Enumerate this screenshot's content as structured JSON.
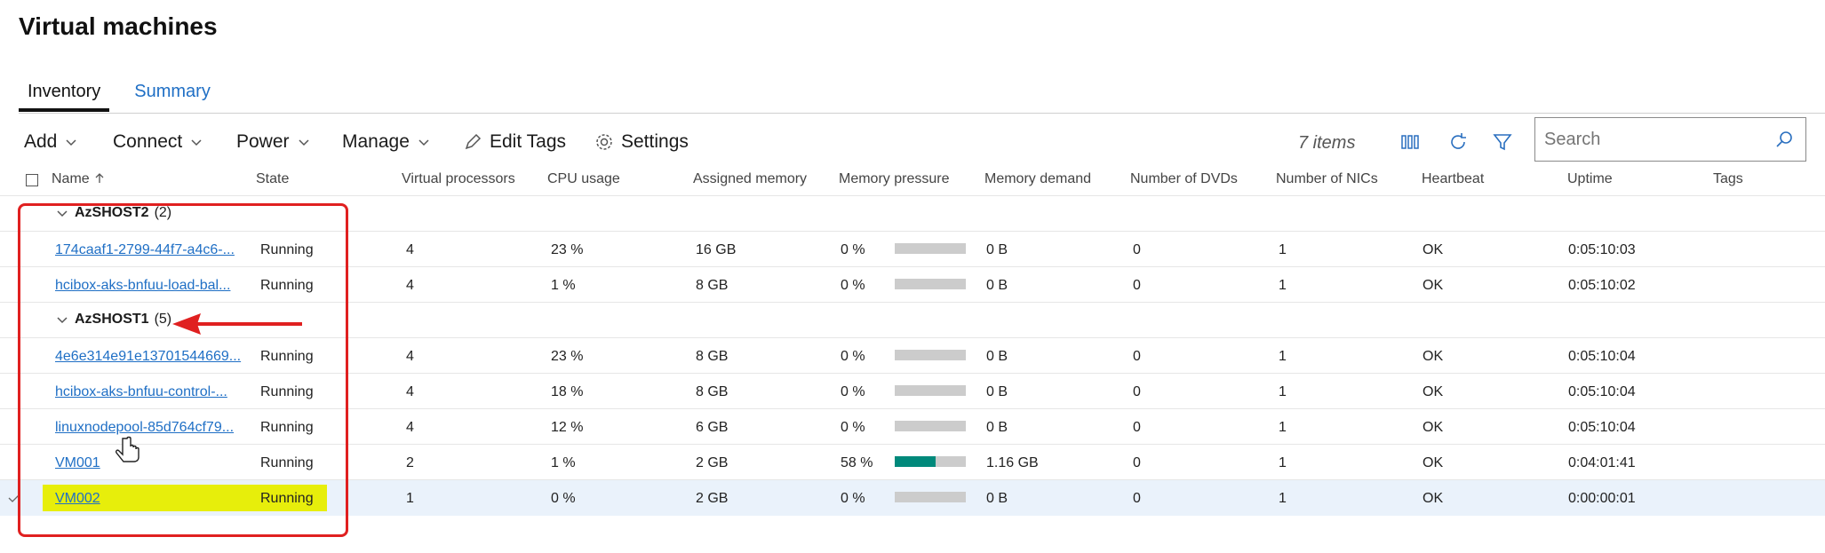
{
  "page": {
    "title": "Virtual machines"
  },
  "tabs": [
    {
      "label": "Inventory",
      "active": true
    },
    {
      "label": "Summary",
      "active": false
    }
  ],
  "toolbar": {
    "add": "Add",
    "connect": "Connect",
    "power": "Power",
    "manage": "Manage",
    "edit_tags": "Edit Tags",
    "settings": "Settings",
    "items_count": "7 items",
    "search_placeholder": "Search"
  },
  "columns": {
    "name": "Name",
    "state": "State",
    "vproc": "Virtual processors",
    "cpu": "CPU usage",
    "mem": "Assigned memory",
    "pressure": "Memory pressure",
    "demand": "Memory demand",
    "dvds": "Number of DVDs",
    "nics": "Number of NICs",
    "heartbeat": "Heartbeat",
    "uptime": "Uptime",
    "tags": "Tags"
  },
  "groups": [
    {
      "name": "AzSHOST2",
      "count": "(2)",
      "rows": [
        {
          "name": "174caaf1-2799-44f7-a4c6-...",
          "state": "Running",
          "vproc": "4",
          "cpu": "23 %",
          "mem": "16 GB",
          "pressure": "0 %",
          "pressure_fraction": 0,
          "demand": "0 B",
          "dvds": "0",
          "nics": "1",
          "heartbeat": "OK",
          "uptime": "0:05:10:03"
        },
        {
          "name": "hcibox-aks-bnfuu-load-bal...",
          "state": "Running",
          "vproc": "4",
          "cpu": "1 %",
          "mem": "8 GB",
          "pressure": "0 %",
          "pressure_fraction": 0,
          "demand": "0 B",
          "dvds": "0",
          "nics": "1",
          "heartbeat": "OK",
          "uptime": "0:05:10:02"
        }
      ]
    },
    {
      "name": "AzSHOST1",
      "count": "(5)",
      "rows": [
        {
          "name": "4e6e314e91e13701544669...",
          "state": "Running",
          "vproc": "4",
          "cpu": "23 %",
          "mem": "8 GB",
          "pressure": "0 %",
          "pressure_fraction": 0,
          "demand": "0 B",
          "dvds": "0",
          "nics": "1",
          "heartbeat": "OK",
          "uptime": "0:05:10:04"
        },
        {
          "name": "hcibox-aks-bnfuu-control-...",
          "state": "Running",
          "vproc": "4",
          "cpu": "18 %",
          "mem": "8 GB",
          "pressure": "0 %",
          "pressure_fraction": 0,
          "demand": "0 B",
          "dvds": "0",
          "nics": "1",
          "heartbeat": "OK",
          "uptime": "0:05:10:04"
        },
        {
          "name": "linuxnodepool-85d764cf79...",
          "state": "Running",
          "vproc": "4",
          "cpu": "12 %",
          "mem": "6 GB",
          "pressure": "0 %",
          "pressure_fraction": 0,
          "demand": "0 B",
          "dvds": "0",
          "nics": "1",
          "heartbeat": "OK",
          "uptime": "0:05:10:04"
        },
        {
          "name": "VM001",
          "state": "Running",
          "vproc": "2",
          "cpu": "1 %",
          "mem": "2 GB",
          "pressure": "58 %",
          "pressure_fraction": 0.58,
          "demand": "1.16 GB",
          "dvds": "0",
          "nics": "1",
          "heartbeat": "OK",
          "uptime": "0:04:01:41"
        },
        {
          "name": "VM002",
          "state": "Running",
          "vproc": "1",
          "cpu": "0 %",
          "mem": "2 GB",
          "pressure": "0 %",
          "pressure_fraction": 0,
          "demand": "0 B",
          "dvds": "0",
          "nics": "1",
          "heartbeat": "OK",
          "uptime": "0:00:00:01",
          "selected": true
        }
      ]
    }
  ],
  "colors": {
    "accent": "#1f6fc5",
    "highlight": "#e7ee0b",
    "annotation": "#e02020",
    "pressure_fill": "#00897b",
    "pressure_track": "#cccccc"
  }
}
